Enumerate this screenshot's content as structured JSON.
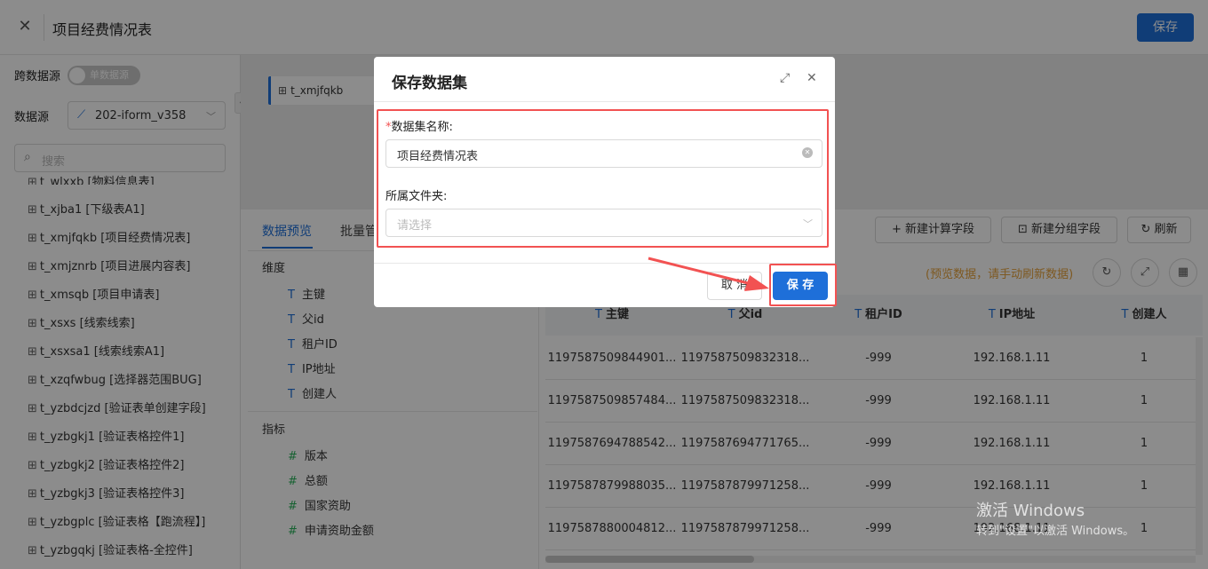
{
  "header": {
    "title": "项目经费情况表",
    "save_label": "保存"
  },
  "sidebar": {
    "cross_source_label": "跨数据源",
    "toggle_text": "单数据源",
    "datasource_label": "数据源",
    "datasource_value": "202-iform_v358",
    "search_placeholder": "搜索",
    "tables": [
      "t_wlxxb [物料信息表]",
      "t_xjba1 [下级表A1]",
      "t_xmjfqkb [项目经费情况表]",
      "t_xmjznrb [项目进展内容表]",
      "t_xmsqb [项目申请表]",
      "t_xsxs [线索线索]",
      "t_xsxsa1 [线索线索A1]",
      "t_xzqfwbug [选择器范围BUG]",
      "t_yzbdcjzd [验证表单创建字段]",
      "t_yzbgkj1 [验证表格控件1]",
      "t_yzbgkj2 [验证表格控件2]",
      "t_yzbgkj3 [验证表格控件3]",
      "t_yzbgplc [验证表格【跑流程】]",
      "t_yzbgqkj [验证表格-全控件]"
    ]
  },
  "canvas": {
    "node_label": "t_xmjfqkb"
  },
  "tabs": {
    "preview": "数据预览",
    "batch": "批量管"
  },
  "toolbar": {
    "calc_field": "新建计算字段",
    "group_field": "新建分组字段",
    "refresh": "刷新"
  },
  "fields": {
    "dimension_title": "维度",
    "dimensions": [
      "主键",
      "父id",
      "租户ID",
      "IP地址",
      "创建人"
    ],
    "metric_title": "指标",
    "metrics": [
      "版本",
      "总额",
      "国家资助",
      "申请资助金额"
    ]
  },
  "preview": {
    "hint": "(预览数据，请手动刷新数据)",
    "columns": [
      "主键",
      "父id",
      "租户ID",
      "IP地址",
      "创建人"
    ],
    "rows": [
      [
        "1197587509844901...",
        "1197587509832318...",
        "-999",
        "192.168.1.11",
        "1"
      ],
      [
        "1197587509857484...",
        "1197587509832318...",
        "-999",
        "192.168.1.11",
        "1"
      ],
      [
        "1197587694788542...",
        "1197587694771765...",
        "-999",
        "192.168.1.11",
        "1"
      ],
      [
        "1197587879988035...",
        "1197587879971258...",
        "-999",
        "192.168.1.11",
        "1"
      ],
      [
        "1197587880004812...",
        "1197587879971258...",
        "-999",
        "192.168.1.11",
        "1"
      ]
    ]
  },
  "dialog": {
    "title": "保存数据集",
    "name_label": "数据集名称:",
    "name_value": "项目经费情况表",
    "folder_label": "所属文件夹:",
    "folder_placeholder": "请选择",
    "cancel_label": "取 消",
    "save_label": "保 存"
  },
  "watermark": {
    "line1": "激活 Windows",
    "line2": "转到\"设置\"以激活 Windows。"
  },
  "colors": {
    "primary": "#1e6fd9",
    "highlight": "#f25252",
    "hint": "#e6a23c",
    "metric_icon": "#2bb35c"
  }
}
